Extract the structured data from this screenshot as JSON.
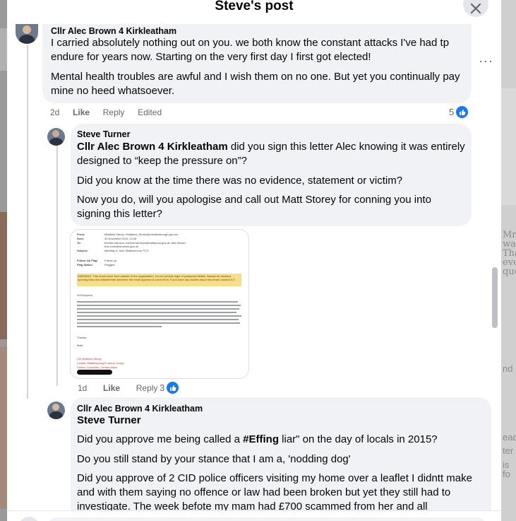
{
  "modal": {
    "title": "Steve's post"
  },
  "icons": {
    "close": "close-icon",
    "more": "more-options-icon",
    "like": "like-thumb-icon"
  },
  "comments": [
    {
      "author": "Cllr Alec Brown 4 Kirkleatham",
      "paragraphs": [
        "I carried absolutely nothing out on you. we both know the constant attacks I've had tp endure for years now. Starting on the very first day I first got elected!",
        "Mental health troubles are awful and I wish them on no one. But yet you continually pay mine no heed whatsoever."
      ],
      "time": "2d",
      "like": "Like",
      "reply": "Reply",
      "edited": "Edited",
      "reactions": "5"
    },
    {
      "author": "Steve Turner",
      "mention": "Cllr Alec Brown 4 Kirkleatham",
      "p1_rest": " did you sign this letter Alec knowing it was entirely designed to “keep the pressure on”?",
      "p2": "Did you know at the time there was no evidence, statement or victim?",
      "p3": "Now you do, will you apologise and call out Matt Storey for conning you into signing this letter?",
      "time": "1d",
      "like": "Like",
      "reply": "Reply",
      "reactions": "3"
    },
    {
      "author": "Cllr Alec Brown 4 Kirkleatham",
      "mention": "Steve Turner",
      "p1_pre": "Did you approve me being called a ",
      "p1_bold": "#Effing",
      "p1_post": " liar\" on the day of locals in 2015?",
      "p2": "Do you still stand by your stance that I am a, 'nodding dog'",
      "p3": "Did you approve of 2 CID police officers visiting my home over a leaflet I didntt make and with them saying no offence or law had been broken but yet they still had to investigate. The week befote my mam had £700 scammed from her and all"
    }
  ],
  "email": {
    "from_label": "From:",
    "from": "Matthew Storey <Matthew_Storey@middlesbrough.gov.uk>",
    "sent_label": "Sent:",
    "sent": "30 November 2021 13:45",
    "to_label": "To:",
    "to": "brenda harrison; brenda.harrison@hartlepool.gov.uk; Alec Brown;",
    "cc": "bob.cook@stockton.gov.uk",
    "subject_label": "Subject:",
    "subject": "Meeting re Joint Statement on PCC",
    "followup_label": "Follow Up Flag:",
    "followup": "Follow up",
    "flag_label": "Flag Status:",
    "flag": "Flagged",
    "warning": "WARNING: This email came from outside of the organisation. Do not provide login or password details. Always be cautious opening links and attachments wherever the email appears to come from. If you have any doubts about this email, contact ICT.",
    "greeting": "Hi Everyone,",
    "thanks": "Thanks,",
    "sign": "Matt",
    "sig1": "Cllr Matthew Storey",
    "sig2": "Leader, Middlesbrough Labour Group",
    "sig3": "Labour Councillor, Central Ward"
  },
  "backdrop_right": [
    "Mr",
    "wa",
    "Tha",
    "eve",
    "que",
    "nd",
    "ead",
    "ter",
    "is fo"
  ]
}
